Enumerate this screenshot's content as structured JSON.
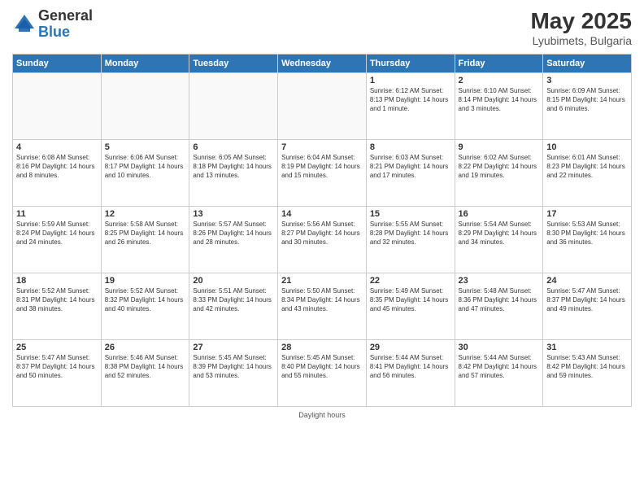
{
  "logo": {
    "general": "General",
    "blue": "Blue"
  },
  "title": "May 2025",
  "subtitle": "Lyubimets, Bulgaria",
  "days_header": [
    "Sunday",
    "Monday",
    "Tuesday",
    "Wednesday",
    "Thursday",
    "Friday",
    "Saturday"
  ],
  "weeks": [
    [
      {
        "day": "",
        "info": ""
      },
      {
        "day": "",
        "info": ""
      },
      {
        "day": "",
        "info": ""
      },
      {
        "day": "",
        "info": ""
      },
      {
        "day": "1",
        "info": "Sunrise: 6:12 AM\nSunset: 8:13 PM\nDaylight: 14 hours\nand 1 minute."
      },
      {
        "day": "2",
        "info": "Sunrise: 6:10 AM\nSunset: 8:14 PM\nDaylight: 14 hours\nand 3 minutes."
      },
      {
        "day": "3",
        "info": "Sunrise: 6:09 AM\nSunset: 8:15 PM\nDaylight: 14 hours\nand 6 minutes."
      }
    ],
    [
      {
        "day": "4",
        "info": "Sunrise: 6:08 AM\nSunset: 8:16 PM\nDaylight: 14 hours\nand 8 minutes."
      },
      {
        "day": "5",
        "info": "Sunrise: 6:06 AM\nSunset: 8:17 PM\nDaylight: 14 hours\nand 10 minutes."
      },
      {
        "day": "6",
        "info": "Sunrise: 6:05 AM\nSunset: 8:18 PM\nDaylight: 14 hours\nand 13 minutes."
      },
      {
        "day": "7",
        "info": "Sunrise: 6:04 AM\nSunset: 8:19 PM\nDaylight: 14 hours\nand 15 minutes."
      },
      {
        "day": "8",
        "info": "Sunrise: 6:03 AM\nSunset: 8:21 PM\nDaylight: 14 hours\nand 17 minutes."
      },
      {
        "day": "9",
        "info": "Sunrise: 6:02 AM\nSunset: 8:22 PM\nDaylight: 14 hours\nand 19 minutes."
      },
      {
        "day": "10",
        "info": "Sunrise: 6:01 AM\nSunset: 8:23 PM\nDaylight: 14 hours\nand 22 minutes."
      }
    ],
    [
      {
        "day": "11",
        "info": "Sunrise: 5:59 AM\nSunset: 8:24 PM\nDaylight: 14 hours\nand 24 minutes."
      },
      {
        "day": "12",
        "info": "Sunrise: 5:58 AM\nSunset: 8:25 PM\nDaylight: 14 hours\nand 26 minutes."
      },
      {
        "day": "13",
        "info": "Sunrise: 5:57 AM\nSunset: 8:26 PM\nDaylight: 14 hours\nand 28 minutes."
      },
      {
        "day": "14",
        "info": "Sunrise: 5:56 AM\nSunset: 8:27 PM\nDaylight: 14 hours\nand 30 minutes."
      },
      {
        "day": "15",
        "info": "Sunrise: 5:55 AM\nSunset: 8:28 PM\nDaylight: 14 hours\nand 32 minutes."
      },
      {
        "day": "16",
        "info": "Sunrise: 5:54 AM\nSunset: 8:29 PM\nDaylight: 14 hours\nand 34 minutes."
      },
      {
        "day": "17",
        "info": "Sunrise: 5:53 AM\nSunset: 8:30 PM\nDaylight: 14 hours\nand 36 minutes."
      }
    ],
    [
      {
        "day": "18",
        "info": "Sunrise: 5:52 AM\nSunset: 8:31 PM\nDaylight: 14 hours\nand 38 minutes."
      },
      {
        "day": "19",
        "info": "Sunrise: 5:52 AM\nSunset: 8:32 PM\nDaylight: 14 hours\nand 40 minutes."
      },
      {
        "day": "20",
        "info": "Sunrise: 5:51 AM\nSunset: 8:33 PM\nDaylight: 14 hours\nand 42 minutes."
      },
      {
        "day": "21",
        "info": "Sunrise: 5:50 AM\nSunset: 8:34 PM\nDaylight: 14 hours\nand 43 minutes."
      },
      {
        "day": "22",
        "info": "Sunrise: 5:49 AM\nSunset: 8:35 PM\nDaylight: 14 hours\nand 45 minutes."
      },
      {
        "day": "23",
        "info": "Sunrise: 5:48 AM\nSunset: 8:36 PM\nDaylight: 14 hours\nand 47 minutes."
      },
      {
        "day": "24",
        "info": "Sunrise: 5:47 AM\nSunset: 8:37 PM\nDaylight: 14 hours\nand 49 minutes."
      }
    ],
    [
      {
        "day": "25",
        "info": "Sunrise: 5:47 AM\nSunset: 8:37 PM\nDaylight: 14 hours\nand 50 minutes."
      },
      {
        "day": "26",
        "info": "Sunrise: 5:46 AM\nSunset: 8:38 PM\nDaylight: 14 hours\nand 52 minutes."
      },
      {
        "day": "27",
        "info": "Sunrise: 5:45 AM\nSunset: 8:39 PM\nDaylight: 14 hours\nand 53 minutes."
      },
      {
        "day": "28",
        "info": "Sunrise: 5:45 AM\nSunset: 8:40 PM\nDaylight: 14 hours\nand 55 minutes."
      },
      {
        "day": "29",
        "info": "Sunrise: 5:44 AM\nSunset: 8:41 PM\nDaylight: 14 hours\nand 56 minutes."
      },
      {
        "day": "30",
        "info": "Sunrise: 5:44 AM\nSunset: 8:42 PM\nDaylight: 14 hours\nand 57 minutes."
      },
      {
        "day": "31",
        "info": "Sunrise: 5:43 AM\nSunset: 8:42 PM\nDaylight: 14 hours\nand 59 minutes."
      }
    ]
  ],
  "footer": "Daylight hours"
}
